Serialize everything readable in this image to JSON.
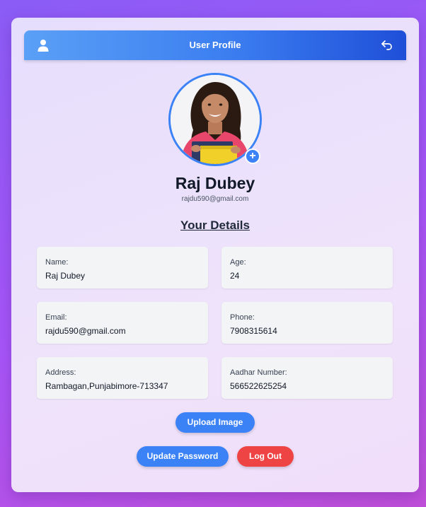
{
  "header": {
    "title": "User Profile",
    "icons": {
      "left": "user-icon",
      "right": "back-arrow-icon"
    }
  },
  "profile": {
    "name": "Raj Dubey",
    "email": "rajdu590@gmail.com",
    "add_icon": "plus-icon"
  },
  "details": {
    "title": "Your Details",
    "fields": [
      {
        "label": "Name:",
        "value": "Raj Dubey"
      },
      {
        "label": "Age:",
        "value": "24"
      },
      {
        "label": "Email:",
        "value": "rajdu590@gmail.com"
      },
      {
        "label": "Phone:",
        "value": "7908315614"
      },
      {
        "label": "Address:",
        "value": "Rambagan,Punjabimore-713347"
      },
      {
        "label": "Aadhar Number:",
        "value": "566522625254"
      }
    ]
  },
  "actions": {
    "upload_label": "Upload Image",
    "update_password_label": "Update Password",
    "logout_label": "Log Out"
  },
  "colors": {
    "accent": "#3b82f6",
    "danger": "#ef4444",
    "header_start": "#5aa0f6",
    "header_end": "#1f4fd8"
  }
}
